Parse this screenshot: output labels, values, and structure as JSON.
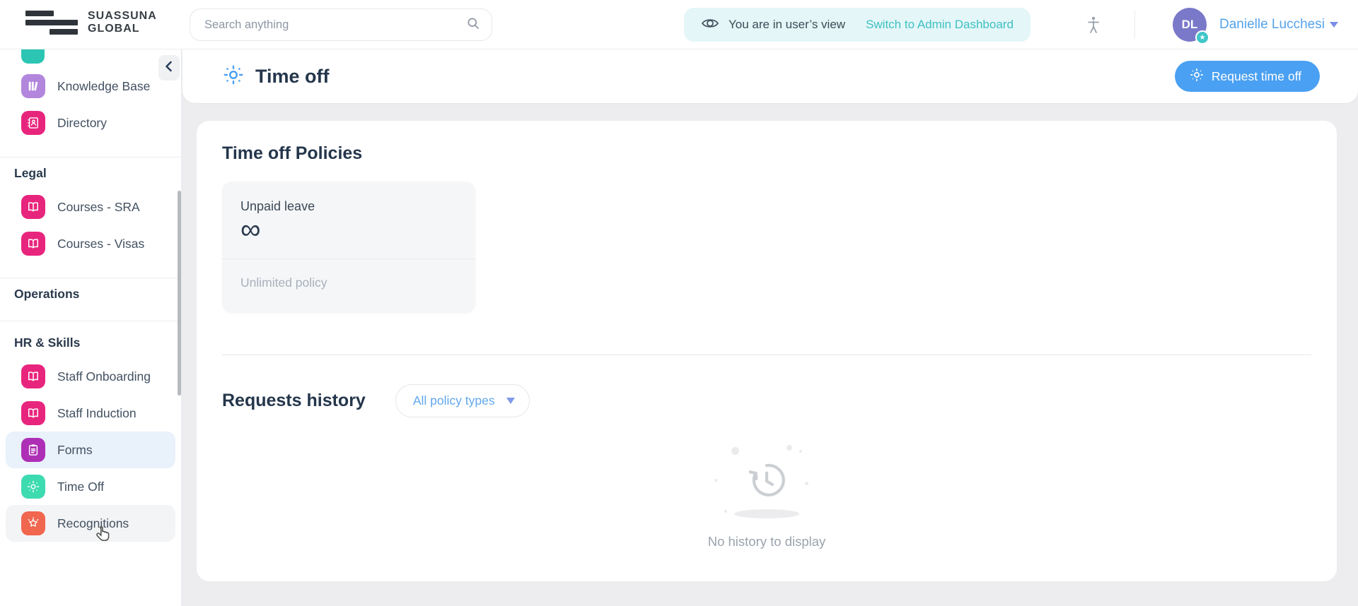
{
  "brand": {
    "name_line1": "SUASSUNA",
    "name_line2": "GLOBAL"
  },
  "header": {
    "search": {
      "placeholder": "Search anything",
      "value": ""
    },
    "view_banner": {
      "message": "You are in user’s view",
      "action": "Switch to Admin Dashboard"
    },
    "user": {
      "initials": "DL",
      "name": "Danielle Lucchesi"
    }
  },
  "icons": {
    "avatar_badge_star": "★",
    "collapse_chevron": "left",
    "infinity": "∞"
  },
  "sidebar": {
    "top_items": [
      {
        "label": "Knowledge Base"
      },
      {
        "label": "Directory"
      }
    ],
    "sections": [
      {
        "title": "Legal",
        "items": [
          {
            "label": "Courses - SRA"
          },
          {
            "label": "Courses - Visas"
          }
        ]
      },
      {
        "title": "Operations",
        "items": []
      },
      {
        "title": "HR & Skills",
        "items": [
          {
            "label": "Staff Onboarding"
          },
          {
            "label": "Staff Induction"
          },
          {
            "label": "Forms",
            "state": "active"
          },
          {
            "label": "Time Off"
          },
          {
            "label": "Recognitions",
            "state": "hovered"
          }
        ]
      }
    ]
  },
  "page": {
    "title": "Time off",
    "request_button": "Request time off"
  },
  "policies": {
    "heading": "Time off Policies",
    "cards": [
      {
        "name": "Unpaid leave",
        "allowance": "∞",
        "type": "Unlimited policy"
      }
    ]
  },
  "history": {
    "heading": "Requests history",
    "filter": "All policy types",
    "empty_message": "No history to display"
  },
  "colors": {
    "accent_blue": "#4aa0f2",
    "teal_link": "#3fc0c4",
    "banner_bg": "#e4f6f7",
    "avatar_purple": "#7a79c9",
    "user_name_blue": "#55a3ea",
    "icon_pink": "#e8257d",
    "icon_lavender": "#b286dd",
    "icon_magenta": "#ad2fb5",
    "icon_green": "#3ddbb0",
    "icon_orange": "#f0664e",
    "active_item_bg": "#e9f1fb"
  }
}
